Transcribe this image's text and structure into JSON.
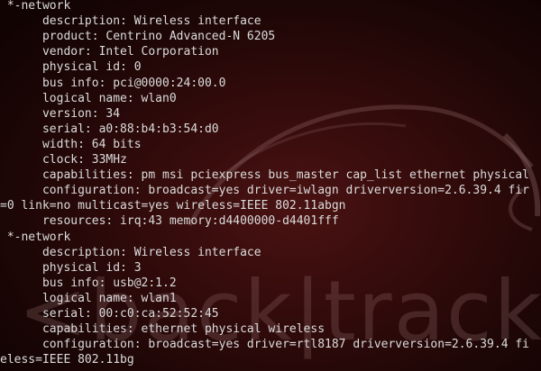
{
  "terminal": {
    "lines": [
      " *-network",
      "      description: Wireless interface",
      "      product: Centrino Advanced-N 6205",
      "      vendor: Intel Corporation",
      "      physical id: 0",
      "      bus info: pci@0000:24:00.0",
      "      logical name: wlan0",
      "      version: 34",
      "      serial: a0:88:b4:b3:54:d0",
      "      width: 64 bits",
      "      clock: 33MHz",
      "      capabilities: pm msi pciexpress bus_master cap_list ethernet physical",
      "      configuration: broadcast=yes driver=iwlagn driverversion=2.6.39.4 fir",
      "=0 link=no multicast=yes wireless=IEEE 802.11abgn",
      "      resources: irq:43 memory:d4400000-d4401fff",
      " *-network",
      "      description: Wireless interface",
      "      physical id: 3",
      "      bus info: usb@2:1.2",
      "      logical name: wlan1",
      "      serial: 00:c0:ca:52:52:45",
      "      capabilities: ethernet physical wireless",
      "      configuration: broadcast=yes driver=rtl8187 driverversion=2.6.39.4 fi",
      "eless=IEEE 802.11bg"
    ]
  },
  "watermark": {
    "text": "<back|track"
  }
}
